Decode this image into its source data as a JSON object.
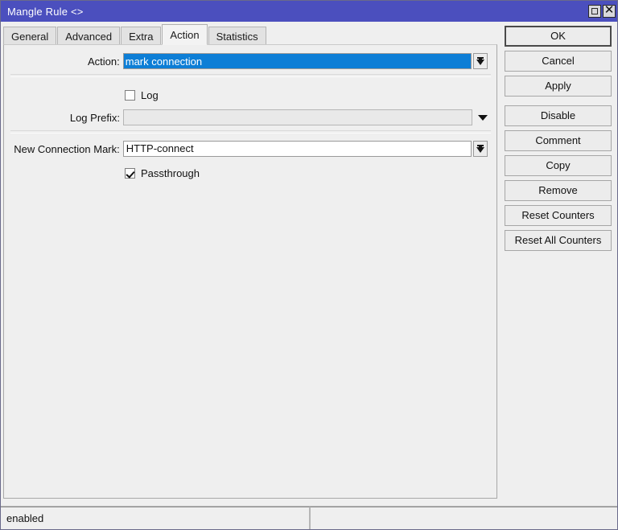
{
  "window": {
    "title": "Mangle Rule <>",
    "title_color": "#4b4fbe",
    "maximize_icon": "maximize-icon",
    "close_icon": "close-icon",
    "close_glyph": "✕"
  },
  "tabs": [
    {
      "label": "General",
      "active": false
    },
    {
      "label": "Advanced",
      "active": false
    },
    {
      "label": "Extra",
      "active": false
    },
    {
      "label": "Action",
      "active": true
    },
    {
      "label": "Statistics",
      "active": false
    }
  ],
  "form": {
    "action": {
      "label": "Action:",
      "value": "mark connection",
      "selected": true,
      "selection_color": "#0d7ed6",
      "dropdown_icon": "combo-arrow-icon"
    },
    "log": {
      "label": "Log",
      "checked": false
    },
    "log_prefix": {
      "label": "Log Prefix:",
      "value": "",
      "placeholder": "",
      "disabled": true,
      "dropdown_icon": "chevron-down-icon"
    },
    "new_connection_mark": {
      "label": "New Connection Mark:",
      "value": "HTTP-connect",
      "dropdown_icon": "combo-arrow-icon"
    },
    "passthrough": {
      "label": "Passthrough",
      "checked": true
    }
  },
  "buttons": [
    {
      "label": "OK",
      "default": true
    },
    {
      "label": "Cancel",
      "default": false
    },
    {
      "label": "Apply",
      "default": false
    },
    {
      "label": "Disable",
      "default": false
    },
    {
      "label": "Comment",
      "default": false
    },
    {
      "label": "Copy",
      "default": false
    },
    {
      "label": "Remove",
      "default": false
    },
    {
      "label": "Reset Counters",
      "default": false
    },
    {
      "label": "Reset All Counters",
      "default": false
    }
  ],
  "statusbar": {
    "left": "enabled",
    "right": ""
  }
}
